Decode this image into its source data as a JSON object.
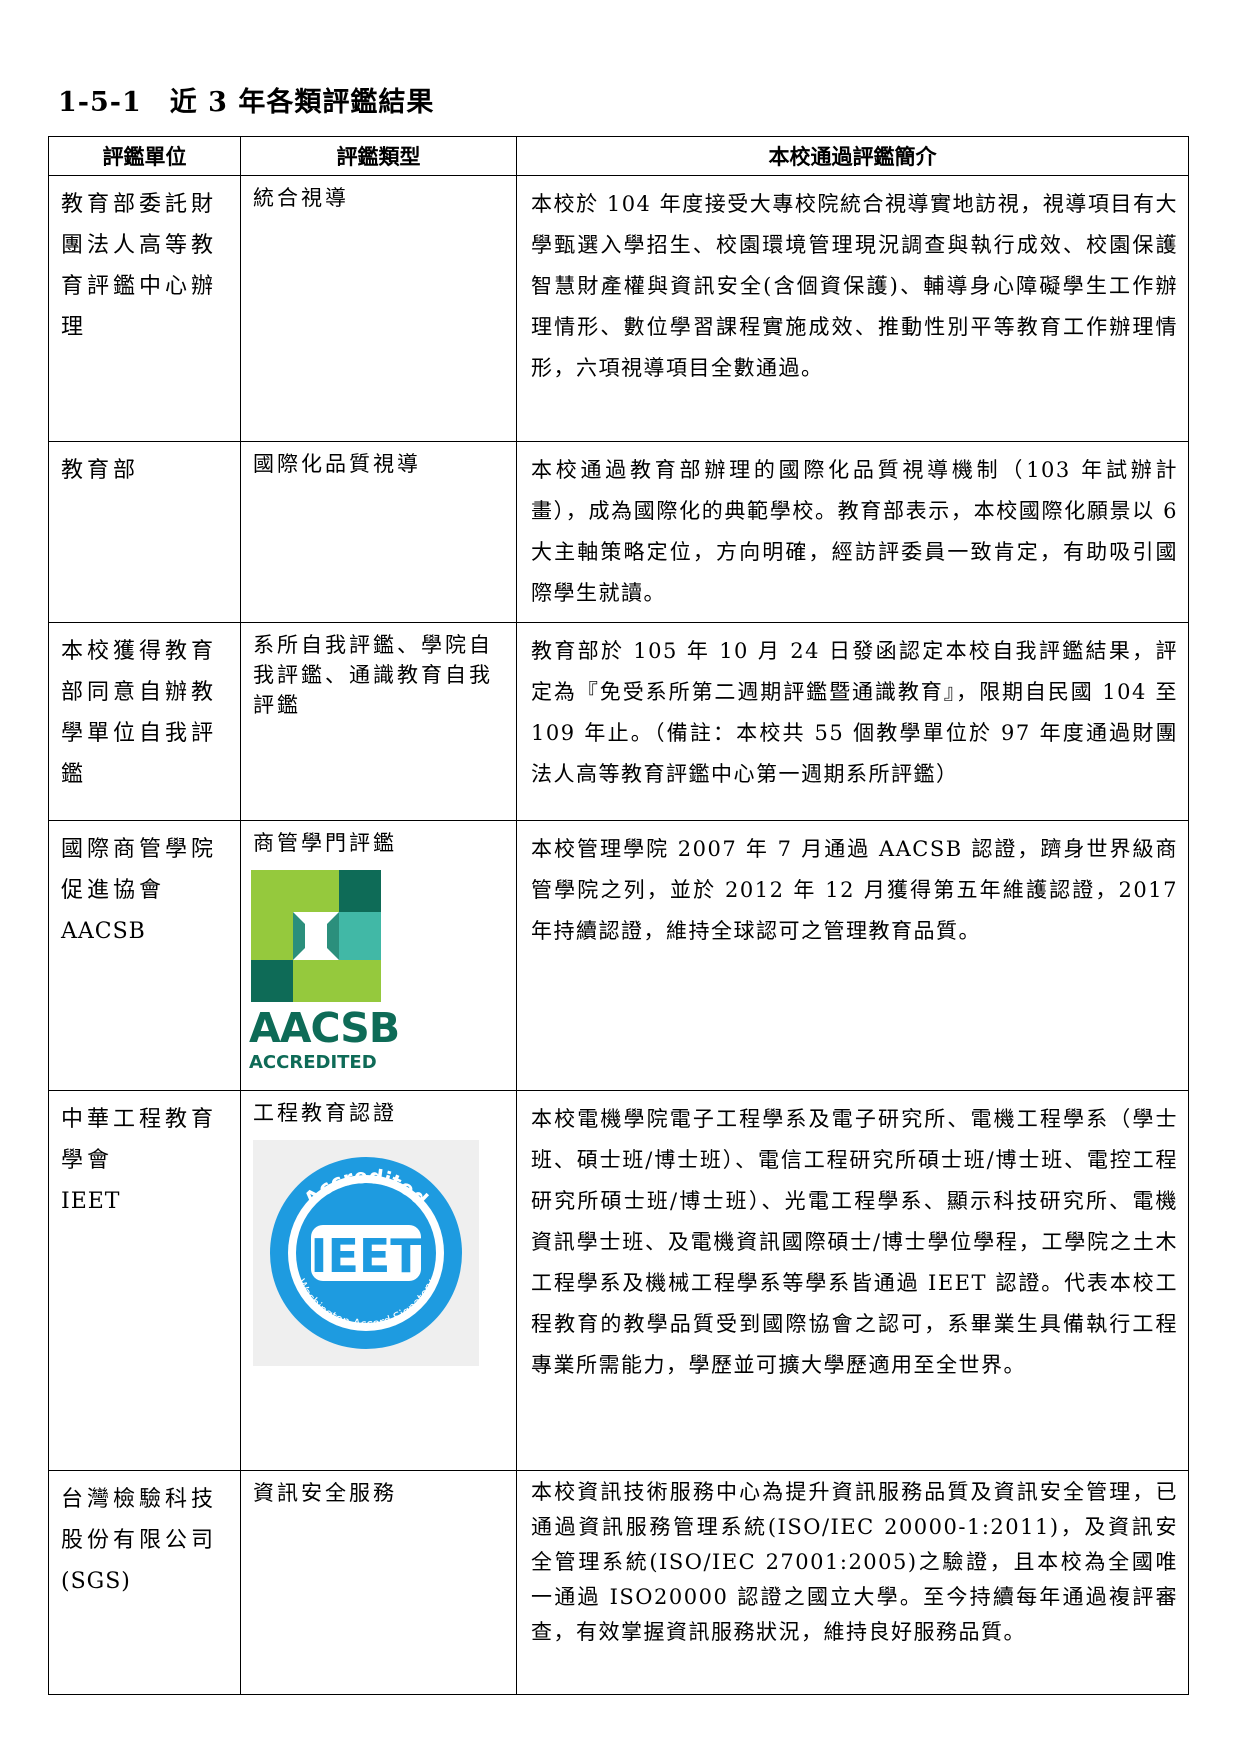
{
  "title": "1-5-1　近 3 年各類評鑑結果",
  "headers": [
    "評鑑單位",
    "評鑑類型",
    "本校通過評鑑簡介"
  ],
  "rows": [
    {
      "unit": "教育部委託財團法人高等教育評鑑中心辦理",
      "type": "統合視導",
      "intro": "本校於 104 年度接受大專校院統合視導實地訪視，視導項目有大學甄選入學招生、校園環境管理現況調查與執行成效、校園保護智慧財產權與資訊安全(含個資保護)、輔導身心障礙學生工作辦理情形、數位學習課程實施成效、推動性別平等教育工作辦理情形，六項視導項目全數通過。"
    },
    {
      "unit": "教育部",
      "type": "國際化品質視導",
      "intro": "本校通過教育部辦理的國際化品質視導機制（103 年試辦計畫），成為國際化的典範學校。教育部表示，本校國際化願景以 6 大主軸策略定位，方向明確，經訪評委員一致肯定，有助吸引國際學生就讀。"
    },
    {
      "unit": "本校獲得教育部同意自辦教學單位自我評鑑",
      "type": "系所自我評鑑、學院自我評鑑、通識教育自我評鑑",
      "intro": "教育部於 105 年 10 月 24 日發函認定本校自我評鑑結果，評定為『免受系所第二週期評鑑暨通識教育』，限期自民國 104 至 109 年止。（備註：本校共 55 個教學單位於 97 年度通過財團法人高等教育評鑑中心第一週期系所評鑑）"
    },
    {
      "unit_line1": "國際商管學院促進協會",
      "unit_line2": "AACSB",
      "type": "商管學門評鑑",
      "intro": "本校管理學院 2007 年 7 月通過 AACSB 認證，躋身世界級商管學院之列，並於 2012 年 12 月獲得第五年維護認證，2017 年持續認證，維持全球認可之管理教育品質。",
      "logo_text": "AACSB",
      "logo_sub": "ACCREDITED"
    },
    {
      "unit_line1": "中華工程教育學會",
      "unit_line2": "IEET",
      "type": "工程教育認證",
      "intro": "本校電機學院電子工程學系及電子研究所、電機工程學系（學士班、碩士班/博士班）、電信工程研究所碩士班/博士班、電控工程研究所碩士班/博士班）、光電工程學系、顯示科技研究所、電機資訊學士班、及電機資訊國際碩士/博士學位學程，工學院之土木工程學系及機械工程學系等學系皆通過 IEET 認證。代表本校工程教育的教學品質受到國際協會之認可，系畢業生具備執行工程專業所需能力，學歷並可擴大學歷適用至全世界。",
      "logo_text": "IEET",
      "logo_ring_top": "Accredited",
      "logo_ring_bottom": "Washington Accord Signatory"
    },
    {
      "unit_line1": "台灣檢驗科技股份有限公司",
      "unit_line2": "(SGS)",
      "type": "資訊安全服務",
      "intro": "本校資訊技術服務中心為提升資訊服務品質及資訊安全管理，已通過資訊服務管理系統(ISO/IEC 20000-1:2011)，及資訊安全管理系統(ISO/IEC 27001:2005)之驗證，且本校為全國唯一通過 ISO20000 認證之國立大學。至今持續每年通過複評審查，有效掌握資訊服務狀況，維持良好服務品質。"
    }
  ]
}
